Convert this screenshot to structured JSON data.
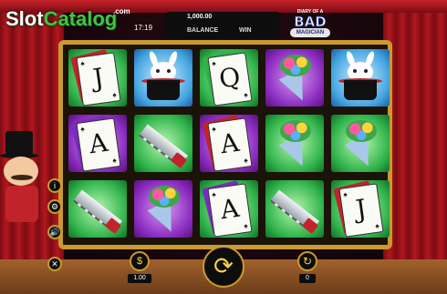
{
  "watermark": {
    "slot": "Slot",
    "catalog": "Catalog",
    "com": ".com"
  },
  "header": {
    "clock": "17:19",
    "balance_value": "1,000.00",
    "balance_label": "BALANCE",
    "win_label": "WIN"
  },
  "game_logo": {
    "top": "DIARY OF A",
    "bad": "BAD",
    "magician": "MAGICIAN"
  },
  "reels": [
    [
      "card-J",
      "card-A",
      "saw"
    ],
    [
      "rabbit",
      "saw",
      "bouquet"
    ],
    [
      "card-Q",
      "card-A",
      "card-A"
    ],
    [
      "bouquet",
      "bouquet",
      "saw"
    ],
    [
      "rabbit",
      "bouquet",
      "card-J"
    ]
  ],
  "symbols": {
    "card-J": {
      "rank": "J",
      "suit": "♠"
    },
    "card-Q": {
      "rank": "Q",
      "suit": "♠"
    },
    "card-A": {
      "rank": "A",
      "suit": "♠"
    }
  },
  "side_buttons": [
    {
      "icon": "info-icon",
      "glyph": "i"
    },
    {
      "icon": "settings-icon",
      "glyph": "⚙"
    },
    {
      "icon": "speaker-icon",
      "glyph": "🔊"
    },
    {
      "icon": "close-icon",
      "glyph": "✕"
    }
  ],
  "controls": {
    "bet_value": "1.00",
    "spin_glyph": "⟳",
    "autoplay_value": "0",
    "autoplay_glyph": "↻",
    "bet_glyph": "$"
  },
  "colors": {
    "frame": "#c99a2d",
    "curtain": "#b3171f"
  }
}
